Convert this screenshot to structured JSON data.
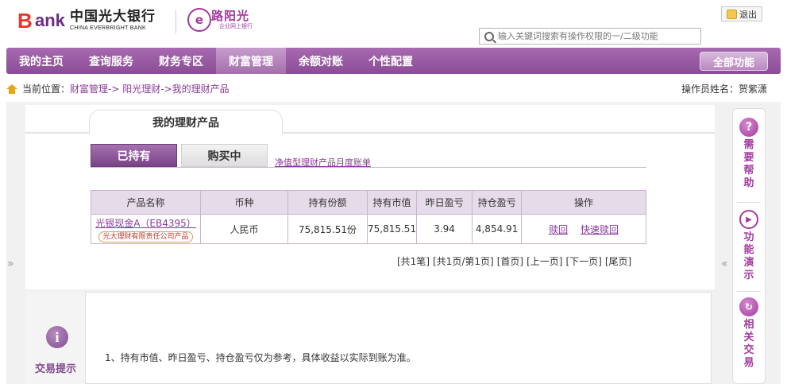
{
  "header": {
    "logo_b": "B",
    "logo_ank": "ank",
    "logo_cn": "中国光大银行",
    "logo_en": "CHINA EVERBRIGHT BANK",
    "sun_badge": "e",
    "sun_title": "路阳光",
    "sun_sub": "企业网上银行",
    "logout_label": "退出",
    "search_placeholder": "输入关键词搜索有操作权限的一/二级功能"
  },
  "nav": {
    "items": [
      {
        "label": "我的主页",
        "active": false
      },
      {
        "label": "查询服务",
        "active": false
      },
      {
        "label": "财务专区",
        "active": false
      },
      {
        "label": "财富管理",
        "active": true
      },
      {
        "label": "余额对账",
        "active": false
      },
      {
        "label": "个性配置",
        "active": false
      }
    ],
    "all_functions": "全部功能"
  },
  "breadcrumb": {
    "prefix": "当前位置：",
    "path": "财富管理-> 阳光理财->我的理财产品"
  },
  "operator": "操作员姓名：贺紫潇",
  "page_title": "我的理财产品",
  "subtabs": {
    "held": "已持有",
    "buying": "购买中",
    "statement_link": "净值型理财产品月度账单"
  },
  "table": {
    "headers": [
      "产品名称",
      "币种",
      "持有份额",
      "持有市值",
      "昨日盈亏",
      "持仓盈亏",
      "操作"
    ],
    "rows": [
      {
        "name": "光银现金A（EB4395）",
        "tag": "光大理财有限责任公司产品",
        "currency": "人民币",
        "shares": "75,815.51份",
        "market_value": "75,815.51",
        "yesterday_pl": "3.94",
        "position_pl": "4,854.91",
        "op_redeem": "赎回",
        "op_fast_redeem": "快速赎回"
      }
    ]
  },
  "pager": [
    "[共1笔]",
    "[共1页/第1页]",
    "[首页]",
    "[上一页]",
    "[下一页]",
    "[尾页]"
  ],
  "arrows": {
    "left": "»",
    "right": "«"
  },
  "tips": {
    "icon": "i",
    "label": "交易提示",
    "text": "1、持有市值、昨日盈亏、持仓盈亏仅为参考，具体收益以实际到账为准。"
  },
  "sidebar": {
    "help": {
      "icon": "?",
      "label": "需要帮助"
    },
    "demo": {
      "icon": "▶",
      "label": "功能演示"
    },
    "related": {
      "icon": "↻",
      "label": "相关交易"
    }
  }
}
